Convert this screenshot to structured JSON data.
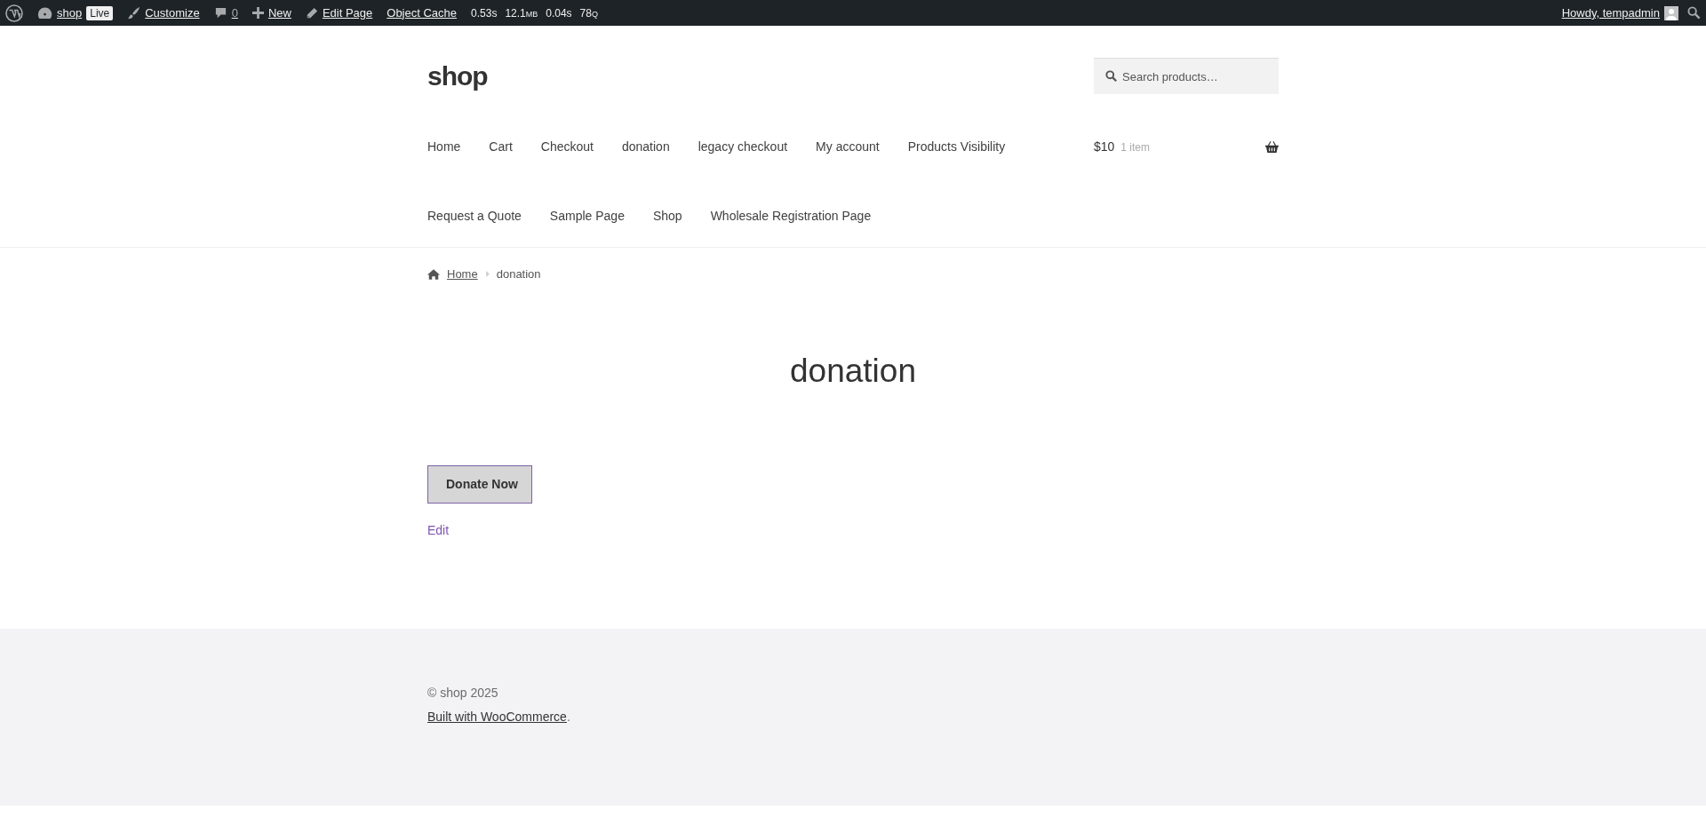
{
  "admin_bar": {
    "site": "shop",
    "live_badge": "Live",
    "customize": "Customize",
    "comments": "0",
    "new": "New",
    "edit_page": "Edit Page",
    "object_cache": "Object Cache",
    "stats": [
      {
        "value": "0.53s"
      },
      {
        "value": "12.1",
        "unit": "MB"
      },
      {
        "value": "0.04s"
      },
      {
        "value": "78",
        "unit": "Q"
      }
    ],
    "greeting": "Howdy, tempadmin"
  },
  "header": {
    "site_title": "shop",
    "search": {
      "placeholder": "Search products…"
    },
    "nav_rows": [
      [
        {
          "label": "Home"
        },
        {
          "label": "Cart"
        },
        {
          "label": "Checkout"
        },
        {
          "label": "donation"
        },
        {
          "label": "legacy checkout"
        },
        {
          "label": "My account"
        },
        {
          "label": "Products Visibility"
        }
      ],
      [
        {
          "label": "Request a Quote"
        },
        {
          "label": "Sample Page"
        },
        {
          "label": "Shop"
        },
        {
          "label": "Wholesale Registration Page"
        }
      ]
    ],
    "cart": {
      "amount": "$10",
      "count": "1 item"
    }
  },
  "breadcrumb": [
    {
      "label": "Home",
      "link": true
    },
    {
      "label": "donation",
      "link": false
    }
  ],
  "page": {
    "title": "donation",
    "button": "Donate Now",
    "edit_link": "Edit"
  },
  "footer": {
    "copyright": "© shop 2025",
    "credit_link": "Built with WooCommerce",
    "credit_tail": "."
  }
}
